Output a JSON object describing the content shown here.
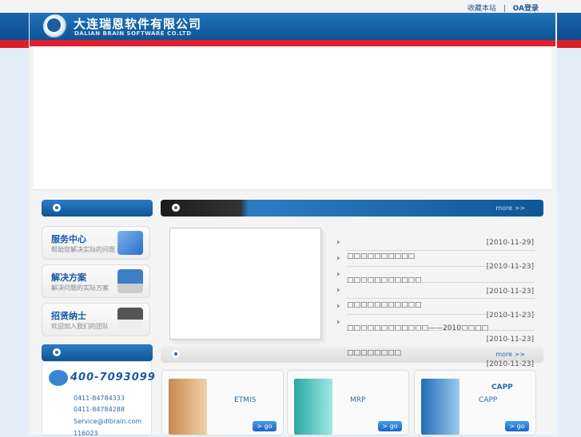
{
  "header": {
    "company_cn": "大连瑞恩软件有限公司",
    "company_en": "DALIAN BRAIN SOFTWARE CO.LTD",
    "links": [
      "收藏本站",
      "OA登录"
    ],
    "separator": "|"
  },
  "services": [
    {
      "title": "服务中心",
      "subtitle": "帮助您解决实际的问题",
      "icon": "cube-icon"
    },
    {
      "title": "解决方案",
      "subtitle": "解决问题的实际方案",
      "icon": "computer-icon"
    },
    {
      "title": "招贤纳士",
      "subtitle": "欢迎加入我们的团队",
      "icon": "graduation-cap-icon"
    }
  ],
  "contact": {
    "hotline": "400-7093099",
    "lines": [
      "0411-84784333",
      "0411-84784288",
      "Service@dlbrain.com",
      "116023"
    ]
  },
  "news": {
    "more": "more >>",
    "items": [
      {
        "title": "",
        "date": "[2010-11-29]"
      },
      {
        "title": "□□□□□□□□□□",
        "date": "[2010-11-23]"
      },
      {
        "title": "□□□□□□□□□□□",
        "date": "[2010-11-23]"
      },
      {
        "title": "□□□□□□□□□□□",
        "date": "[2010-11-23]"
      },
      {
        "title": "□□□□□□□□□□□□——2010□□□□",
        "date": "[2010-11-23]"
      },
      {
        "title": "□□□□□□□□",
        "date": "[2010-11-23]"
      }
    ]
  },
  "products": {
    "more": "more >>",
    "items": [
      {
        "name": "ETMIS",
        "heading": "",
        "go": "> go",
        "color": "#e0b07a"
      },
      {
        "name": "MRP",
        "heading": "",
        "go": "> go",
        "color": "#5ccfcb"
      },
      {
        "name": "CAPP",
        "heading": "CAPP",
        "go": "> go",
        "color": "#5aa3de"
      }
    ]
  }
}
